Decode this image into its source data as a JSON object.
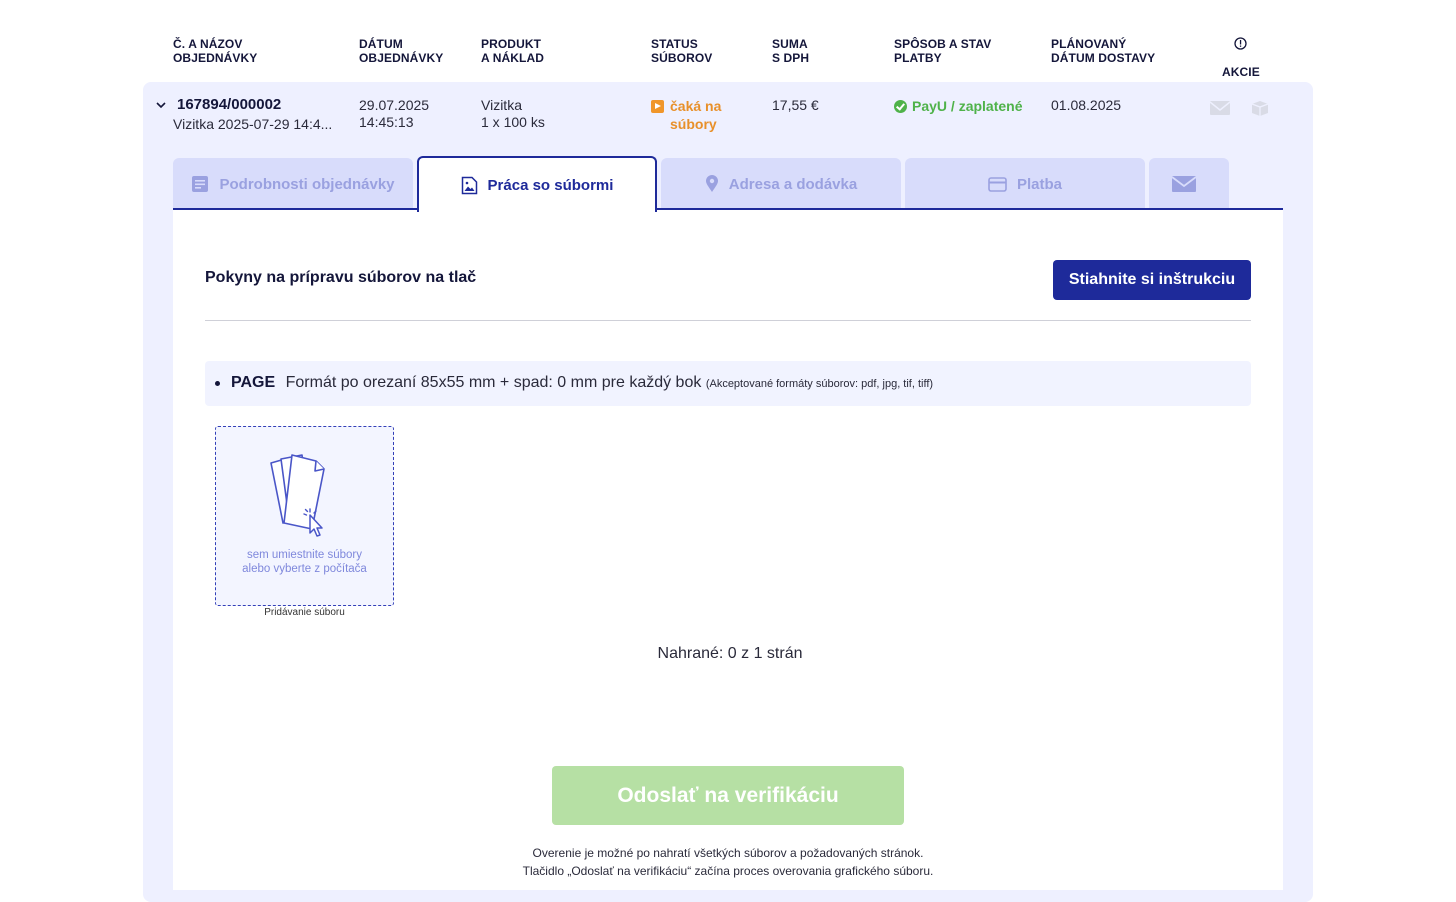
{
  "header": {
    "col_order": [
      "Č. A NÁZOV",
      "OBJEDNÁVKY"
    ],
    "col_date": [
      "DÁTUM",
      "OBJEDNÁVKY"
    ],
    "col_product": [
      "PRODUKT",
      "A NÁKLAD"
    ],
    "col_status": [
      "STATUS",
      "SÚBOROV"
    ],
    "col_sum": [
      "SUMA",
      "S DPH"
    ],
    "col_payment": [
      "SPÔSOB A STAV",
      "PLATBY"
    ],
    "col_delivery": [
      "PLÁNOVANÝ",
      "DÁTUM DOSTAVY"
    ],
    "col_actions": "AKCIE",
    "actions_icon": "info-circle-icon"
  },
  "order": {
    "number": "167894/000002",
    "name": "Vizitka 2025-07-29 14:4...",
    "date": "29.07.2025",
    "time": "14:45:13",
    "product": "Vizitka",
    "quantity": "1 x 100 ks",
    "file_status_1": "čaká na",
    "file_status_2": "súbory",
    "sum": "17,55 €",
    "payment": "PayU / zaplatené",
    "delivery_date": "01.08.2025",
    "colors": {
      "file_status": "#e8902a",
      "payment": "#4fb24a"
    }
  },
  "tabs": [
    {
      "label": "Podrobnosti objednávky",
      "icon": "document-icon",
      "active": false
    },
    {
      "label": "Práca so súbormi",
      "icon": "image-file-icon",
      "active": true
    },
    {
      "label": "Adresa a dodávka",
      "icon": "location-pin-icon",
      "active": false
    },
    {
      "label": "Platba",
      "icon": "credit-card-icon",
      "active": false
    },
    {
      "label": "",
      "icon": "envelope-icon",
      "active": false
    }
  ],
  "panel": {
    "instructions_title": "Pokyny na prípravu súborov na tlač",
    "download_button": "Stiahnite si inštrukciu",
    "format_page": "PAGE",
    "format_text": "Formát po orezaní 85x55 mm + spad: 0 mm pre každý bok",
    "format_note": "(Akceptované formáty súborov: pdf, jpg, tif, tiff)",
    "dropzone_line1": "sem umiestnite súbory",
    "dropzone_line2": "alebo vyberte z počítača",
    "dropzone_caption": "Pridávanie súboru",
    "uploaded": "Nahrané: 0 z 1 strán",
    "verify_button": "Odoslať na verifikáciu",
    "note_line1": "Overenie je možné po nahratí všetkých súborov a požadovaných stránok.",
    "note_line2": "Tlačidlo „Odoslať na verifikáciu“ začína proces overovania grafického súboru."
  },
  "colors": {
    "accent": "#1e2a9a",
    "card_bg": "#eef0ff",
    "verify_disabled": "#b6e0a4"
  }
}
